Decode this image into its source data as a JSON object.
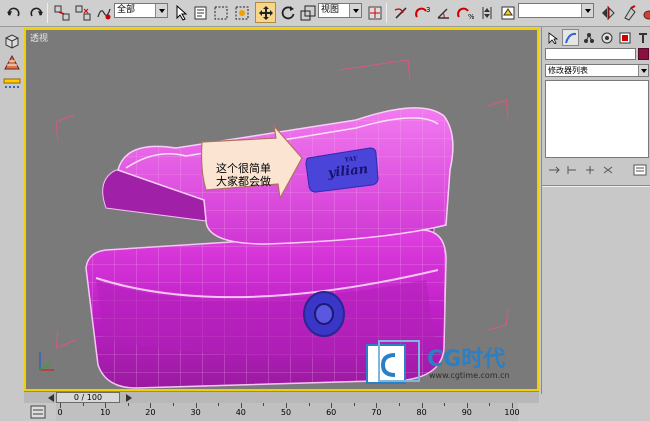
{
  "toolbar": {
    "selection_filter": "全部",
    "ref_coord_system": "视图",
    "named_selection": ""
  },
  "viewport": {
    "label": "透视",
    "callout_line1": "这个很简单",
    "callout_line2": "大家都会做",
    "tag_text_top": "YAY",
    "tag_text": "yilian"
  },
  "command_panel": {
    "modifier_list": "修改器列表",
    "object_color": "#8a1040"
  },
  "time_slider": {
    "frame_display": "0 / 100"
  },
  "track_bar": {
    "ticks": [
      "0",
      "10",
      "20",
      "30",
      "40",
      "50",
      "60",
      "70",
      "80",
      "90",
      "100"
    ]
  },
  "watermark": {
    "brand": "CG时代",
    "url": "www.cgtime.com.cn"
  },
  "icons": [
    "undo-icon",
    "redo-icon",
    "link-icon",
    "unlink-icon",
    "bind-space-warp-icon",
    "select-icon",
    "select-by-name-icon",
    "rect-selection-icon",
    "window-crossing-icon",
    "move-icon",
    "rotate-icon",
    "scale-icon",
    "pivot-icon",
    "mirror-icon",
    "align-icon",
    "snap-icon",
    "angle-snap-icon",
    "percent-snap-icon",
    "spinner-snap-icon",
    "edit-named-sel-icon",
    "render-icon",
    "teapot-icon"
  ]
}
